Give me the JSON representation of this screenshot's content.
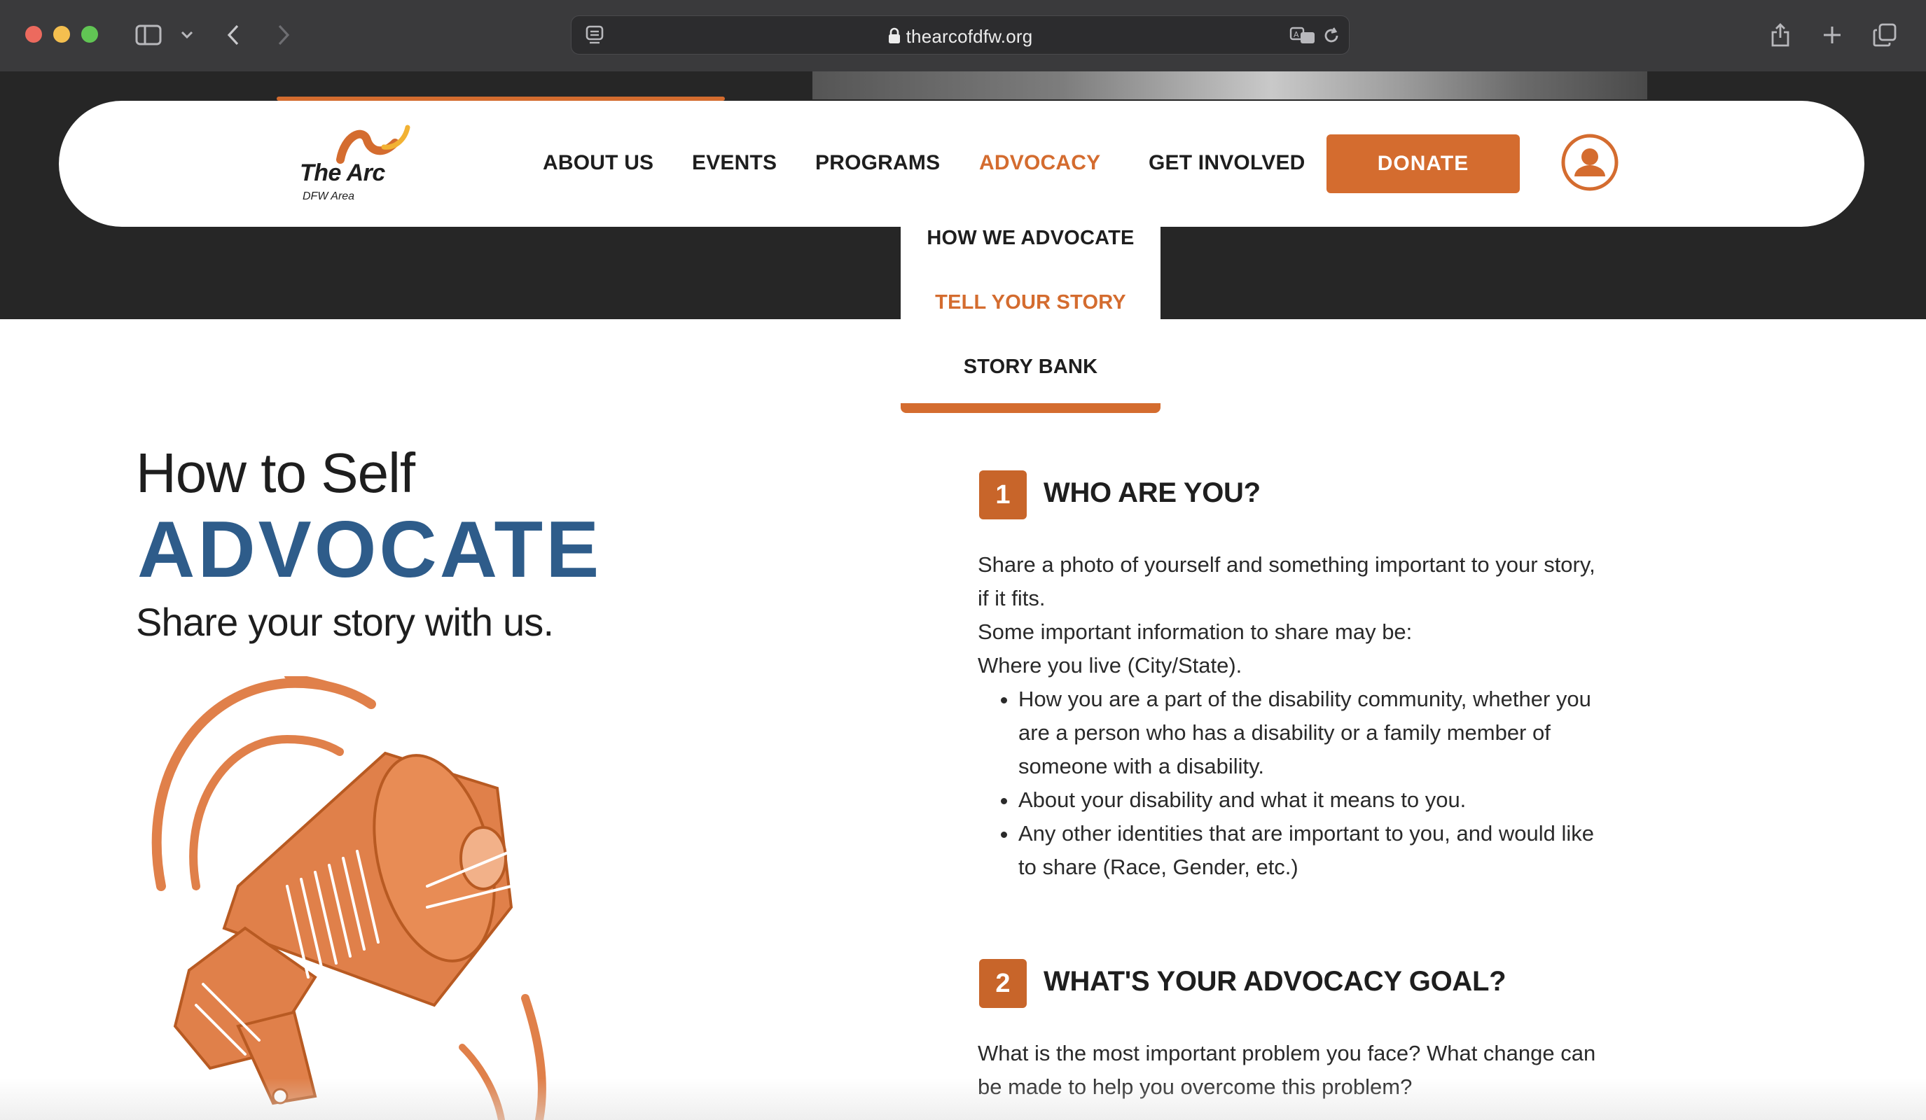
{
  "browser": {
    "url": "thearcofdfw.org"
  },
  "logo": {
    "name": "The Arc",
    "subtitle": "DFW Area"
  },
  "nav": {
    "items": [
      {
        "label": "ABOUT US",
        "active": false
      },
      {
        "label": "EVENTS",
        "active": false
      },
      {
        "label": "PROGRAMS",
        "active": false
      },
      {
        "label": "ADVOCACY",
        "active": true
      },
      {
        "label": "GET INVOLVED",
        "active": false
      }
    ],
    "donate_label": "DONATE"
  },
  "dropdown": {
    "items": [
      {
        "label": "HOW WE ADVOCATE",
        "active": false
      },
      {
        "label": "TELL YOUR STORY",
        "active": true
      },
      {
        "label": "STORY BANK",
        "active": false
      }
    ]
  },
  "hero": {
    "line1": "How to Self",
    "line2": "ADVOCATE",
    "line3": "Share your story with us."
  },
  "steps": [
    {
      "number": "1",
      "title": "WHO ARE YOU?",
      "paragraphs": [
        "Share a photo of yourself and something important to your story, if it fits.",
        "Some important information to share may be:",
        "Where you live (City/State)."
      ],
      "bullets": [
        "How you are a part of the disability community, whether you are a person who has a disability or a family member of someone with a disability.",
        "About your disability and what it means to you.",
        "Any other identities that are important to you, and would like to share (Race, Gender, etc.)"
      ]
    },
    {
      "number": "2",
      "title": "WHAT'S YOUR ADVOCACY GOAL?",
      "paragraphs": [
        "What is the most important problem you face? What change can be made to help you overcome this problem?"
      ]
    }
  ],
  "colors": {
    "accent": "#d46c2f",
    "heading_blue": "#2e5c8a",
    "dark_band": "#262626",
    "chrome": "#3a3a3c"
  }
}
